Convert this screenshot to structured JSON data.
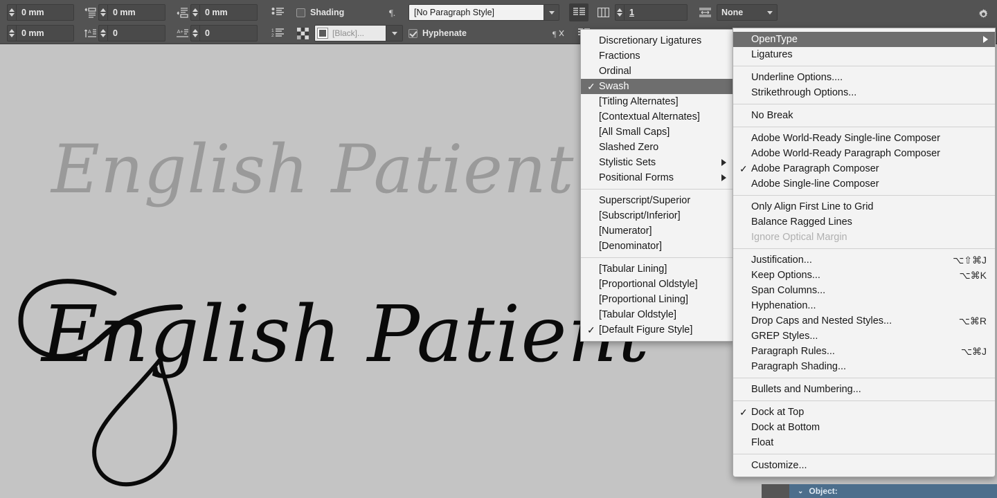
{
  "app": {
    "canvas_bg": "#c4c4c4",
    "toolbar_bg": "#535353",
    "menu_bg": "#f3f3f3",
    "highlight": "#6e6e6e",
    "object_bar_bg": "#4c6e8c"
  },
  "canvas": {
    "line_top": "English Patient",
    "line_bottom": "English Patient",
    "line_top_color": "#9a9a9a",
    "line_bottom_color": "#0a0a0a"
  },
  "toolbar": {
    "left_indent": "0 mm",
    "right_indent": "0 mm",
    "first_line_indent": "0 mm",
    "space_before": "0 mm",
    "space_after": "0",
    "drop_cap_lines": "0",
    "shading_label": "Shading",
    "shading_checked": false,
    "shading_swatch": "[Black]...",
    "paragraph_style": "[No Paragraph Style]",
    "hyphenate_label": "Hyphenate",
    "hyphenate_checked": true,
    "columns_value": "1",
    "span_value": "None",
    "icons": {
      "left_indent": "left-indent-icon",
      "right_indent": "right-indent-icon",
      "first_line_indent": "first-line-indent-icon",
      "space_before": "space-before-icon",
      "space_after": "space-after-icon",
      "bulleted_list": "bulleted-list-icon",
      "numbered_list": "numbered-list-icon",
      "shading_pattern": "shading-pattern-icon",
      "paragraph_mark": "paragraph-mark-icon",
      "align_left": "align-left-icon",
      "align_justify": "align-justify-icon",
      "columns": "columns-icon",
      "span_columns": "span-columns-icon",
      "no_break": "no-break-icon",
      "panel_options": "gear-icon"
    }
  },
  "opentype_menu": {
    "title": "OpenType",
    "groups": [
      {
        "items": [
          {
            "label": "Discretionary Ligatures",
            "checked": false,
            "submenu": false,
            "disabled": false,
            "selected": false
          },
          {
            "label": "Fractions",
            "checked": false,
            "submenu": false,
            "disabled": false,
            "selected": false
          },
          {
            "label": "Ordinal",
            "checked": false,
            "submenu": false,
            "disabled": false,
            "selected": false
          },
          {
            "label": "Swash",
            "checked": true,
            "submenu": false,
            "disabled": false,
            "selected": true
          },
          {
            "label": "[Titling Alternates]",
            "checked": false,
            "submenu": false,
            "disabled": false,
            "selected": false
          },
          {
            "label": "[Contextual Alternates]",
            "checked": false,
            "submenu": false,
            "disabled": false,
            "selected": false
          },
          {
            "label": "[All Small Caps]",
            "checked": false,
            "submenu": false,
            "disabled": false,
            "selected": false
          },
          {
            "label": "Slashed Zero",
            "checked": false,
            "submenu": false,
            "disabled": false,
            "selected": false
          },
          {
            "label": "Stylistic Sets",
            "checked": false,
            "submenu": true,
            "disabled": false,
            "selected": false
          },
          {
            "label": "Positional Forms",
            "checked": false,
            "submenu": true,
            "disabled": false,
            "selected": false
          }
        ]
      },
      {
        "items": [
          {
            "label": "Superscript/Superior",
            "checked": false,
            "submenu": false,
            "disabled": false,
            "selected": false
          },
          {
            "label": "[Subscript/Inferior]",
            "checked": false,
            "submenu": false,
            "disabled": false,
            "selected": false
          },
          {
            "label": "[Numerator]",
            "checked": false,
            "submenu": false,
            "disabled": false,
            "selected": false
          },
          {
            "label": "[Denominator]",
            "checked": false,
            "submenu": false,
            "disabled": false,
            "selected": false
          }
        ]
      },
      {
        "items": [
          {
            "label": "[Tabular Lining]",
            "checked": false,
            "submenu": false,
            "disabled": false,
            "selected": false
          },
          {
            "label": "[Proportional Oldstyle]",
            "checked": false,
            "submenu": false,
            "disabled": false,
            "selected": false
          },
          {
            "label": "[Proportional Lining]",
            "checked": false,
            "submenu": false,
            "disabled": false,
            "selected": false
          },
          {
            "label": "[Tabular Oldstyle]",
            "checked": false,
            "submenu": false,
            "disabled": false,
            "selected": false
          },
          {
            "label": "[Default Figure Style]",
            "checked": true,
            "submenu": false,
            "disabled": false,
            "selected": false
          }
        ]
      }
    ]
  },
  "paragraph_panel_menu": {
    "groups": [
      {
        "items": [
          {
            "label": "OpenType",
            "shortcut": "",
            "checked": false,
            "submenu": true,
            "disabled": false,
            "selected": true
          },
          {
            "label": "Ligatures",
            "shortcut": "",
            "checked": false,
            "submenu": false,
            "disabled": false,
            "selected": false
          }
        ]
      },
      {
        "items": [
          {
            "label": "Underline Options....",
            "shortcut": "",
            "checked": false,
            "submenu": false,
            "disabled": false,
            "selected": false
          },
          {
            "label": "Strikethrough Options...",
            "shortcut": "",
            "checked": false,
            "submenu": false,
            "disabled": false,
            "selected": false
          }
        ]
      },
      {
        "items": [
          {
            "label": "No Break",
            "shortcut": "",
            "checked": false,
            "submenu": false,
            "disabled": false,
            "selected": false
          }
        ]
      },
      {
        "items": [
          {
            "label": "Adobe World-Ready Single-line Composer",
            "shortcut": "",
            "checked": false,
            "submenu": false,
            "disabled": false,
            "selected": false
          },
          {
            "label": "Adobe World-Ready Paragraph Composer",
            "shortcut": "",
            "checked": false,
            "submenu": false,
            "disabled": false,
            "selected": false
          },
          {
            "label": "Adobe Paragraph Composer",
            "shortcut": "",
            "checked": true,
            "submenu": false,
            "disabled": false,
            "selected": false
          },
          {
            "label": "Adobe Single-line Composer",
            "shortcut": "",
            "checked": false,
            "submenu": false,
            "disabled": false,
            "selected": false
          }
        ]
      },
      {
        "items": [
          {
            "label": "Only Align First Line to Grid",
            "shortcut": "",
            "checked": false,
            "submenu": false,
            "disabled": false,
            "selected": false
          },
          {
            "label": "Balance Ragged Lines",
            "shortcut": "",
            "checked": false,
            "submenu": false,
            "disabled": false,
            "selected": false
          },
          {
            "label": "Ignore Optical Margin",
            "shortcut": "",
            "checked": false,
            "submenu": false,
            "disabled": true,
            "selected": false
          }
        ]
      },
      {
        "items": [
          {
            "label": "Justification...",
            "shortcut": "⌥⇧⌘J",
            "checked": false,
            "submenu": false,
            "disabled": false,
            "selected": false
          },
          {
            "label": "Keep Options...",
            "shortcut": "⌥⌘K",
            "checked": false,
            "submenu": false,
            "disabled": false,
            "selected": false
          },
          {
            "label": "Span Columns...",
            "shortcut": "",
            "checked": false,
            "submenu": false,
            "disabled": false,
            "selected": false
          },
          {
            "label": "Hyphenation...",
            "shortcut": "",
            "checked": false,
            "submenu": false,
            "disabled": false,
            "selected": false
          },
          {
            "label": "Drop Caps and Nested Styles...",
            "shortcut": "⌥⌘R",
            "checked": false,
            "submenu": false,
            "disabled": false,
            "selected": false
          },
          {
            "label": "GREP Styles...",
            "shortcut": "",
            "checked": false,
            "submenu": false,
            "disabled": false,
            "selected": false
          },
          {
            "label": "Paragraph Rules...",
            "shortcut": "⌥⌘J",
            "checked": false,
            "submenu": false,
            "disabled": false,
            "selected": false
          },
          {
            "label": "Paragraph Shading...",
            "shortcut": "",
            "checked": false,
            "submenu": false,
            "disabled": false,
            "selected": false
          }
        ]
      },
      {
        "items": [
          {
            "label": "Bullets and Numbering...",
            "shortcut": "",
            "checked": false,
            "submenu": false,
            "disabled": false,
            "selected": false
          }
        ]
      },
      {
        "items": [
          {
            "label": "Dock at Top",
            "shortcut": "",
            "checked": true,
            "submenu": false,
            "disabled": false,
            "selected": false
          },
          {
            "label": "Dock at Bottom",
            "shortcut": "",
            "checked": false,
            "submenu": false,
            "disabled": false,
            "selected": false
          },
          {
            "label": "Float",
            "shortcut": "",
            "checked": false,
            "submenu": false,
            "disabled": false,
            "selected": false
          }
        ]
      },
      {
        "items": [
          {
            "label": "Customize...",
            "shortcut": "",
            "checked": false,
            "submenu": false,
            "disabled": false,
            "selected": false
          }
        ]
      }
    ]
  },
  "status_bar": {
    "object_label": "Object:"
  }
}
